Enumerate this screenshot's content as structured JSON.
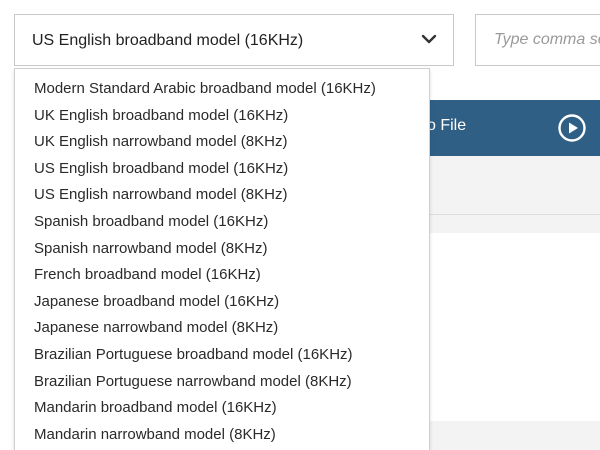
{
  "model_select": {
    "selected": "US English broadband model (16KHz)",
    "chevron_icon": "chevron-down-icon"
  },
  "keywords": {
    "placeholder": "Type comma separated keywords here"
  },
  "action_bar": {
    "label": "Play Audio File",
    "visible_label": "o File",
    "play_icon": "play-circle-icon",
    "color": "#305f86"
  },
  "dropdown": {
    "options": [
      "Modern Standard Arabic broadband model (16KHz)",
      "UK English broadband model (16KHz)",
      "UK English narrowband model (8KHz)",
      "US English broadband model (16KHz)",
      "US English narrowband model (8KHz)",
      "Spanish broadband model (16KHz)",
      "Spanish narrowband model (8KHz)",
      "French broadband model (16KHz)",
      "Japanese broadband model (16KHz)",
      "Japanese narrowband model (8KHz)",
      "Brazilian Portuguese broadband model (16KHz)",
      "Brazilian Portuguese narrowband model (8KHz)",
      "Mandarin broadband model (16KHz)",
      "Mandarin narrowband model (8KHz)"
    ]
  }
}
